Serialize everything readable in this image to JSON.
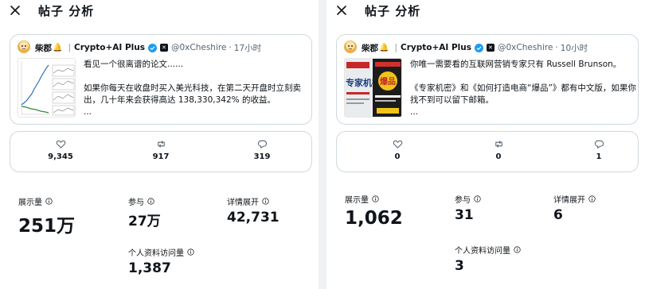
{
  "panels": [
    {
      "header": {
        "title": "帖子 分析",
        "close_icon": "close-icon"
      },
      "tweet": {
        "display_name": "柴郡",
        "name_emoji": "🔔",
        "community": "Crypto+AI Plus",
        "handle": "@0xCheshire",
        "time": "17小时",
        "text": "看见一个很离谱的论文......\n\n如果你每天在收盘时买入美光科技，在第二天开盘时立刻卖出，几十年来会获得高达 138,330,342% 的收益。\n..."
      },
      "engagement": {
        "likes": "9,345",
        "reposts": "917",
        "replies": "319"
      },
      "stats": {
        "impressions": {
          "label": "展示量",
          "value": "251万"
        },
        "engagements": {
          "label": "参与",
          "value": "27万"
        },
        "detail_expands": {
          "label": "详情展开",
          "value": "42,731"
        },
        "profile_visits": {
          "label": "个人资料访问量",
          "value": "1,387"
        }
      }
    },
    {
      "header": {
        "title": "帖子 分析",
        "close_icon": "close-icon"
      },
      "tweet": {
        "display_name": "柴郡",
        "name_emoji": "🔔",
        "community": "Crypto+AI Plus",
        "handle": "@0xCheshire",
        "time": "10小时",
        "text": "你唯一需要看的互联网营销专家只有 Russell Brunson。\n\n《专家机密》和《如何打造电商“爆品”》都有中文版，如果你找不到可以留下邮箱。\n...",
        "book_title_1": "专家机密",
        "book_title_2": "爆品"
      },
      "engagement": {
        "likes": "0",
        "reposts": "0",
        "replies": "1"
      },
      "stats": {
        "impressions": {
          "label": "展示量",
          "value": "1,062"
        },
        "engagements": {
          "label": "参与",
          "value": "31"
        },
        "detail_expands": {
          "label": "详情展开",
          "value": "6"
        },
        "profile_visits": {
          "label": "个人资料访问量",
          "value": "3"
        }
      }
    }
  ],
  "colors": {
    "text": "#0f1419",
    "muted": "#536471",
    "border": "#cfd9de",
    "verified": "#1d9bf0",
    "background": "#eff1f3"
  },
  "icons": [
    "close-icon",
    "verified-icon",
    "x-badge-icon",
    "heart-icon",
    "repost-icon",
    "reply-icon",
    "info-icon"
  ]
}
